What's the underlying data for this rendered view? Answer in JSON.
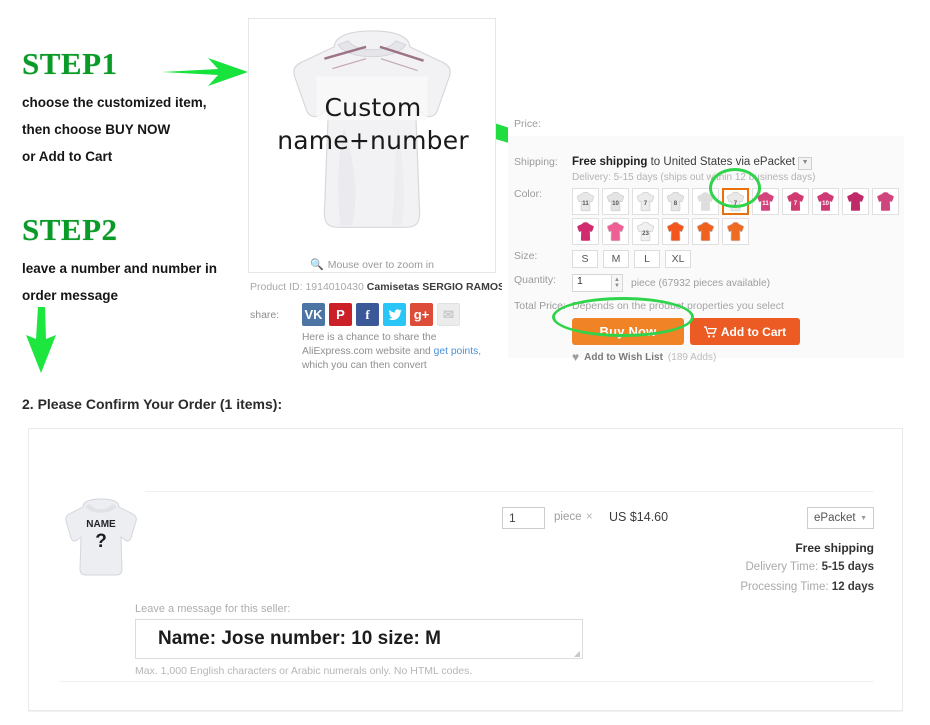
{
  "steps": {
    "step1": {
      "title": "STEP1",
      "lines": [
        "choose the customized item,",
        "then choose BUY NOW",
        "or Add to Cart"
      ]
    },
    "step2": {
      "title": "STEP2",
      "lines": [
        "leave a number and number in",
        "order message"
      ]
    }
  },
  "product_image": {
    "overlay_text_line1": "Custom",
    "overlay_text_line2": "name+number",
    "zoom_hint": "Mouse over to zoom in",
    "product_id_label": "Product ID: 1914010430",
    "product_title": "Camisetas SERGIO RAMOS Soccer",
    "product_title_ellipsis": "..."
  },
  "share": {
    "label": "share:",
    "icons": [
      {
        "name": "vk-icon",
        "glyph": "VK"
      },
      {
        "name": "pinterest-icon",
        "glyph": "P"
      },
      {
        "name": "facebook-icon",
        "glyph": "f"
      },
      {
        "name": "twitter-icon",
        "glyph": "t"
      },
      {
        "name": "google-plus-icon",
        "glyph": "g+"
      },
      {
        "name": "email-icon",
        "glyph": "✉"
      }
    ],
    "blurb_part1": "Here is a chance to share the AliExpress.com website and ",
    "blurb_link": "get points",
    "blurb_part2": ", which you can then convert"
  },
  "detail": {
    "price_label": "Price:",
    "shipping_label": "Shipping:",
    "shipping_free": "Free shipping",
    "shipping_rest": " to United States via ePacket",
    "shipping_caret": "▼",
    "shipping_sub": "Delivery: 5-15 days (ships out within 12 business days)",
    "color_label": "Color:",
    "color_swatches": [
      {
        "name": "swatch-white-11",
        "color": "#e8e8e8",
        "number": "11",
        "selected": false
      },
      {
        "name": "swatch-white-10",
        "color": "#e4e4e4",
        "number": "10",
        "selected": false
      },
      {
        "name": "swatch-white-7",
        "color": "#ececec",
        "number": "7",
        "selected": false
      },
      {
        "name": "swatch-white-8",
        "color": "#e6e6e6",
        "number": "8",
        "selected": false
      },
      {
        "name": "swatch-white-plain",
        "color": "#dedede",
        "number": "",
        "selected": false
      },
      {
        "name": "swatch-white-selected",
        "color": "#e9e9e9",
        "number": "7",
        "selected": true
      },
      {
        "name": "swatch-pink-11",
        "color": "#d4447c",
        "number": "11",
        "selected": false
      },
      {
        "name": "swatch-pink-7",
        "color": "#d23a72",
        "number": "7",
        "selected": false
      },
      {
        "name": "swatch-pink-10",
        "color": "#cf3a74",
        "number": "10",
        "selected": false
      },
      {
        "name": "swatch-magenta-plain",
        "color": "#c12a69",
        "number": "",
        "selected": false
      },
      {
        "name": "swatch-pink-plain",
        "color": "#d1457e",
        "number": "",
        "selected": false
      },
      {
        "name": "swatch-magenta-2",
        "color": "#d22a6e",
        "number": "",
        "selected": false
      },
      {
        "name": "swatch-lightpink",
        "color": "#ee5f93",
        "number": "",
        "selected": false
      },
      {
        "name": "swatch-white-23",
        "color": "#f0f0f0",
        "number": "23",
        "selected": false
      },
      {
        "name": "swatch-orange-1",
        "color": "#f4551a",
        "number": "",
        "selected": false
      },
      {
        "name": "swatch-orange-2",
        "color": "#f0611f",
        "number": "",
        "selected": false
      },
      {
        "name": "swatch-orange-3",
        "color": "#ef6a22",
        "number": "",
        "selected": false
      }
    ],
    "size_label": "Size:",
    "sizes": [
      "S",
      "M",
      "L",
      "XL"
    ],
    "quantity_label": "Quantity:",
    "quantity_value": "1",
    "quantity_note": "piece (67932 pieces available)",
    "total_price_label": "Total Price:",
    "total_price_note": "Depends on the product properties you select",
    "buy_now_label": "Buy Now",
    "add_to_cart_label": "Add to Cart",
    "cart_icon": "🛒",
    "wish_list_label": "Add to Wish List",
    "wish_list_count": "(189 Adds)",
    "heart_icon": "♥"
  },
  "confirm": {
    "title": "2. Please Confirm Your Order (1 items):",
    "thumb_name_text": "NAME",
    "thumb_number_text": "?",
    "qty_value": "1",
    "piece_label": "piece",
    "times_symbol": "×",
    "price": "US $14.60",
    "shipping_method": "ePacket",
    "shipping_caret": "▼",
    "free_shipping": "Free shipping",
    "delivery_time_label": "Delivery Time:",
    "delivery_time_value": "5-15 days",
    "processing_time_label": "Processing Time:",
    "processing_time_value": "12 days",
    "message_label": "Leave a message for this seller:",
    "message_value": "Name: Jose number: 10 size: M",
    "message_hint": "Max. 1,000 English characters or Arabic numerals only. No HTML codes."
  },
  "colors": {
    "green_accent": "#2fd44b",
    "green_title": "#0a9a28",
    "orange_buy": "#ef8326",
    "orange_cart": "#ec5b24",
    "selected_swatch_border": "#e9700d"
  }
}
